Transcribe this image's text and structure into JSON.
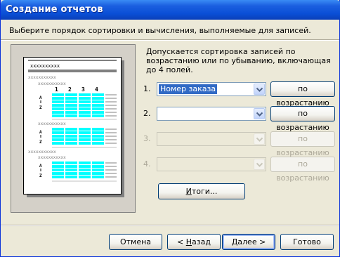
{
  "window": {
    "title": "Создание отчетов"
  },
  "header": {
    "instruction": "Выберите порядок сортировки и вычисления, выполняемые для записей."
  },
  "description": "Допускается сортировка записей по возрастанию или по убыванию, включающая до 4 полей.",
  "preview": {
    "placeholder": "xxxxxxxxxx",
    "small_placeholder": "xxxxxxxxxxx",
    "column_numbers": [
      "1",
      "2",
      "3",
      "4"
    ],
    "sort_letters": [
      "A",
      "Z"
    ]
  },
  "sort_rows": [
    {
      "number": "1.",
      "field": "Номер заказа",
      "order": "по возрастанию",
      "enabled": true
    },
    {
      "number": "2.",
      "field": "",
      "order": "по возрастанию",
      "enabled": true
    },
    {
      "number": "3.",
      "field": "",
      "order": "по возрастанию",
      "enabled": false
    },
    {
      "number": "4.",
      "field": "",
      "order": "по возрастанию",
      "enabled": false
    }
  ],
  "summary_button": {
    "label_pre": "",
    "label_mnemonic": "И",
    "label_post": "тоги..."
  },
  "buttons": {
    "cancel": "Отмена",
    "back_prefix": "< ",
    "back_mnemonic": "Н",
    "back_rest": "азад",
    "next_mnemonic": "Д",
    "next_rest": "алее >",
    "finish": "Готово"
  },
  "colors": {
    "title_bar": "#0a4fd6",
    "highlight": "#316ac5",
    "preview_cells": "#00ffff"
  }
}
